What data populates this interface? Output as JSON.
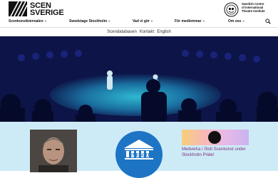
{
  "header": {
    "logo_line1": "SCEN",
    "logo_line2": "SVERIGE",
    "iti_line1": "Swedish Centre",
    "iti_line2": "of International",
    "iti_line3": "Theatre Institute"
  },
  "nav": {
    "items": [
      {
        "label": "Scenkonstbiennalen"
      },
      {
        "label": "Swedstage Stockholm"
      },
      {
        "label": "Vad vi gör"
      },
      {
        "label": "För medlemmar"
      },
      {
        "label": "Om oss"
      }
    ],
    "chevron": "˅"
  },
  "subnav": {
    "items": [
      "Scendatabasen",
      "Kontakt",
      "English"
    ]
  },
  "news": {
    "pride_link": "Medverka i Stolt Scenkonst under Stockholm Pride!",
    "unesco_text": "UNESCO"
  },
  "colors": {
    "hero_bg": "#0d1447",
    "stage": "#1d8fb0",
    "lower_bg": "#cdebf7",
    "link": "#7b2a7b"
  },
  "icons": [
    "logo-mark-icon",
    "iti-globe-icon",
    "search-icon",
    "chevron-down-icon"
  ]
}
